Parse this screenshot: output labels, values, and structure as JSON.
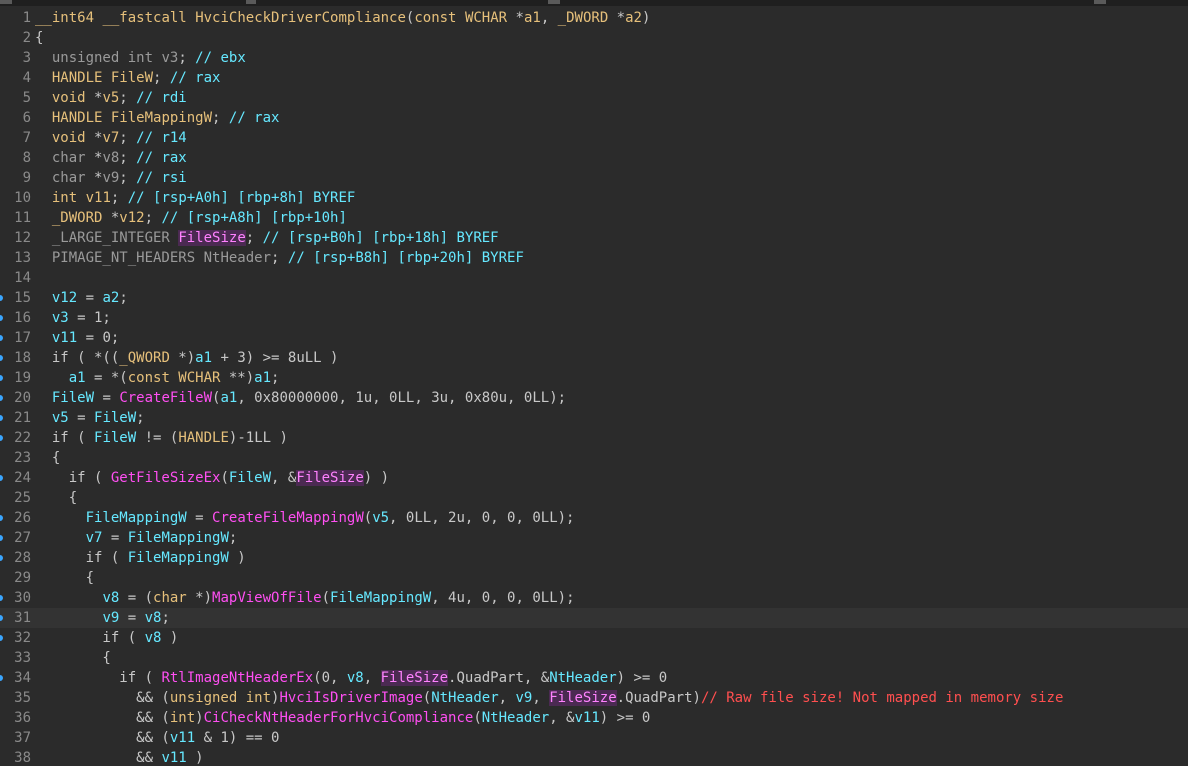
{
  "editor": {
    "lines": [
      {
        "n": "1",
        "bp": false,
        "cur": false,
        "tokens": [
          [
            "kw",
            "__int64"
          ],
          [
            "pu",
            " "
          ],
          [
            "kw",
            "__fastcall"
          ],
          [
            "pu",
            " "
          ],
          [
            "kw",
            "HvciCheckDriverCompliance"
          ],
          [
            "pu",
            "("
          ],
          [
            "kw",
            "const"
          ],
          [
            "pu",
            " "
          ],
          [
            "kw",
            "WCHAR"
          ],
          [
            "pu",
            " *"
          ],
          [
            "kw",
            "a1"
          ],
          [
            "pu",
            ", "
          ],
          [
            "kw",
            "_DWORD"
          ],
          [
            "pu",
            " *"
          ],
          [
            "kw",
            "a2"
          ],
          [
            "pu",
            ")"
          ]
        ]
      },
      {
        "n": "2",
        "bp": false,
        "cur": false,
        "tokens": [
          [
            "pu",
            "{"
          ]
        ]
      },
      {
        "n": "3",
        "bp": false,
        "cur": false,
        "tokens": [
          [
            "pu",
            "  "
          ],
          [
            "ty",
            "unsigned int"
          ],
          [
            "pu",
            " "
          ],
          [
            "ty",
            "v3"
          ],
          [
            "pu",
            "; "
          ],
          [
            "cm",
            "// ebx"
          ]
        ]
      },
      {
        "n": "4",
        "bp": false,
        "cur": false,
        "tokens": [
          [
            "pu",
            "  "
          ],
          [
            "kw",
            "HANDLE"
          ],
          [
            "pu",
            " "
          ],
          [
            "kw",
            "FileW"
          ],
          [
            "pu",
            "; "
          ],
          [
            "cm",
            "// rax"
          ]
        ]
      },
      {
        "n": "5",
        "bp": false,
        "cur": false,
        "tokens": [
          [
            "pu",
            "  "
          ],
          [
            "kw",
            "void"
          ],
          [
            "pu",
            " *"
          ],
          [
            "kw",
            "v5"
          ],
          [
            "pu",
            "; "
          ],
          [
            "cm",
            "// rdi"
          ]
        ]
      },
      {
        "n": "6",
        "bp": false,
        "cur": false,
        "tokens": [
          [
            "pu",
            "  "
          ],
          [
            "kw",
            "HANDLE"
          ],
          [
            "pu",
            " "
          ],
          [
            "kw",
            "FileMappingW"
          ],
          [
            "pu",
            "; "
          ],
          [
            "cm",
            "// rax"
          ]
        ]
      },
      {
        "n": "7",
        "bp": false,
        "cur": false,
        "tokens": [
          [
            "pu",
            "  "
          ],
          [
            "kw",
            "void"
          ],
          [
            "pu",
            " *"
          ],
          [
            "kw",
            "v7"
          ],
          [
            "pu",
            "; "
          ],
          [
            "cm",
            "// r14"
          ]
        ]
      },
      {
        "n": "8",
        "bp": false,
        "cur": false,
        "tokens": [
          [
            "pu",
            "  "
          ],
          [
            "ty",
            "char"
          ],
          [
            "pu",
            " *"
          ],
          [
            "ty",
            "v8"
          ],
          [
            "pu",
            "; "
          ],
          [
            "cm",
            "// rax"
          ]
        ]
      },
      {
        "n": "9",
        "bp": false,
        "cur": false,
        "tokens": [
          [
            "pu",
            "  "
          ],
          [
            "ty",
            "char"
          ],
          [
            "pu",
            " *"
          ],
          [
            "ty",
            "v9"
          ],
          [
            "pu",
            "; "
          ],
          [
            "cm",
            "// rsi"
          ]
        ]
      },
      {
        "n": "10",
        "bp": false,
        "cur": false,
        "tokens": [
          [
            "pu",
            "  "
          ],
          [
            "kw",
            "int"
          ],
          [
            "pu",
            " "
          ],
          [
            "kw",
            "v11"
          ],
          [
            "pu",
            "; "
          ],
          [
            "cm",
            "// [rsp+A0h] [rbp+8h] BYREF"
          ]
        ]
      },
      {
        "n": "11",
        "bp": false,
        "cur": false,
        "tokens": [
          [
            "pu",
            "  "
          ],
          [
            "kw",
            "_DWORD"
          ],
          [
            "pu",
            " *"
          ],
          [
            "kw",
            "v12"
          ],
          [
            "pu",
            "; "
          ],
          [
            "cm",
            "// [rsp+A8h] [rbp+10h]"
          ]
        ]
      },
      {
        "n": "12",
        "bp": false,
        "cur": false,
        "tokens": [
          [
            "pu",
            "  "
          ],
          [
            "ty",
            "_LARGE_INTEGER"
          ],
          [
            "pu",
            " "
          ],
          [
            "hl",
            "FileSize"
          ],
          [
            "pu",
            "; "
          ],
          [
            "cm",
            "// [rsp+B0h] [rbp+18h] BYREF"
          ]
        ]
      },
      {
        "n": "13",
        "bp": false,
        "cur": false,
        "tokens": [
          [
            "pu",
            "  "
          ],
          [
            "ty",
            "PIMAGE_NT_HEADERS"
          ],
          [
            "pu",
            " "
          ],
          [
            "ty",
            "NtHeader"
          ],
          [
            "pu",
            "; "
          ],
          [
            "cm",
            "// [rsp+B8h] [rbp+20h] BYREF"
          ]
        ]
      },
      {
        "n": "14",
        "bp": false,
        "cur": false,
        "tokens": []
      },
      {
        "n": "15",
        "bp": true,
        "cur": false,
        "tokens": [
          [
            "pu",
            "  "
          ],
          [
            "id",
            "v12"
          ],
          [
            "pu",
            " = "
          ],
          [
            "id",
            "a2"
          ],
          [
            "pu",
            ";"
          ]
        ]
      },
      {
        "n": "16",
        "bp": true,
        "cur": false,
        "tokens": [
          [
            "pu",
            "  "
          ],
          [
            "id",
            "v3"
          ],
          [
            "pu",
            " = 1;"
          ]
        ]
      },
      {
        "n": "17",
        "bp": true,
        "cur": false,
        "tokens": [
          [
            "pu",
            "  "
          ],
          [
            "id",
            "v11"
          ],
          [
            "pu",
            " = 0;"
          ]
        ]
      },
      {
        "n": "18",
        "bp": true,
        "cur": false,
        "tokens": [
          [
            "pu",
            "  if ( *(("
          ],
          [
            "kw",
            "_QWORD"
          ],
          [
            "pu",
            " *)"
          ],
          [
            "id",
            "a1"
          ],
          [
            "pu",
            " + 3) >= 8uLL )"
          ]
        ]
      },
      {
        "n": "19",
        "bp": true,
        "cur": false,
        "tokens": [
          [
            "pu",
            "    "
          ],
          [
            "id",
            "a1"
          ],
          [
            "pu",
            " = *("
          ],
          [
            "kw",
            "const WCHAR"
          ],
          [
            "pu",
            " **)"
          ],
          [
            "id",
            "a1"
          ],
          [
            "pu",
            ";"
          ]
        ]
      },
      {
        "n": "20",
        "bp": true,
        "cur": false,
        "tokens": [
          [
            "pu",
            "  "
          ],
          [
            "id",
            "FileW"
          ],
          [
            "pu",
            " = "
          ],
          [
            "fn",
            "CreateFileW"
          ],
          [
            "pu",
            "("
          ],
          [
            "id",
            "a1"
          ],
          [
            "pu",
            ", 0x80000000, 1u, 0LL, 3u, 0x80u, 0LL);"
          ]
        ]
      },
      {
        "n": "21",
        "bp": true,
        "cur": false,
        "tokens": [
          [
            "pu",
            "  "
          ],
          [
            "id",
            "v5"
          ],
          [
            "pu",
            " = "
          ],
          [
            "id",
            "FileW"
          ],
          [
            "pu",
            ";"
          ]
        ]
      },
      {
        "n": "22",
        "bp": true,
        "cur": false,
        "tokens": [
          [
            "pu",
            "  if ( "
          ],
          [
            "id",
            "FileW"
          ],
          [
            "pu",
            " != ("
          ],
          [
            "kw",
            "HANDLE"
          ],
          [
            "pu",
            ")-1LL )"
          ]
        ]
      },
      {
        "n": "23",
        "bp": false,
        "cur": false,
        "tokens": [
          [
            "pu",
            "  {"
          ]
        ]
      },
      {
        "n": "24",
        "bp": true,
        "cur": false,
        "tokens": [
          [
            "pu",
            "    if ( "
          ],
          [
            "fn",
            "GetFileSizeEx"
          ],
          [
            "pu",
            "("
          ],
          [
            "id",
            "FileW"
          ],
          [
            "pu",
            ", &"
          ],
          [
            "hl",
            "FileSize"
          ],
          [
            "pu",
            ") )"
          ]
        ]
      },
      {
        "n": "25",
        "bp": false,
        "cur": false,
        "tokens": [
          [
            "pu",
            "    {"
          ]
        ]
      },
      {
        "n": "26",
        "bp": true,
        "cur": false,
        "tokens": [
          [
            "pu",
            "      "
          ],
          [
            "id",
            "FileMappingW"
          ],
          [
            "pu",
            " = "
          ],
          [
            "fn",
            "CreateFileMappingW"
          ],
          [
            "pu",
            "("
          ],
          [
            "id",
            "v5"
          ],
          [
            "pu",
            ", 0LL, 2u, 0, 0, 0LL);"
          ]
        ]
      },
      {
        "n": "27",
        "bp": true,
        "cur": false,
        "tokens": [
          [
            "pu",
            "      "
          ],
          [
            "id",
            "v7"
          ],
          [
            "pu",
            " = "
          ],
          [
            "id",
            "FileMappingW"
          ],
          [
            "pu",
            ";"
          ]
        ]
      },
      {
        "n": "28",
        "bp": true,
        "cur": false,
        "tokens": [
          [
            "pu",
            "      if ( "
          ],
          [
            "id",
            "FileMappingW"
          ],
          [
            "pu",
            " )"
          ]
        ]
      },
      {
        "n": "29",
        "bp": false,
        "cur": false,
        "tokens": [
          [
            "pu",
            "      {"
          ]
        ]
      },
      {
        "n": "30",
        "bp": true,
        "cur": false,
        "tokens": [
          [
            "pu",
            "        "
          ],
          [
            "id",
            "v8"
          ],
          [
            "pu",
            " = ("
          ],
          [
            "kw",
            "char"
          ],
          [
            "pu",
            " *)"
          ],
          [
            "fn",
            "MapViewOfFile"
          ],
          [
            "pu",
            "("
          ],
          [
            "id",
            "FileMappingW"
          ],
          [
            "pu",
            ", 4u, 0, 0, 0LL);"
          ]
        ]
      },
      {
        "n": "31",
        "bp": true,
        "cur": true,
        "tokens": [
          [
            "pu",
            "        "
          ],
          [
            "id",
            "v9"
          ],
          [
            "pu",
            " = "
          ],
          [
            "id",
            "v8"
          ],
          [
            "pu",
            ";"
          ]
        ]
      },
      {
        "n": "32",
        "bp": true,
        "cur": false,
        "tokens": [
          [
            "pu",
            "        if ( "
          ],
          [
            "id",
            "v8"
          ],
          [
            "pu",
            " )"
          ]
        ]
      },
      {
        "n": "33",
        "bp": false,
        "cur": false,
        "tokens": [
          [
            "pu",
            "        {"
          ]
        ]
      },
      {
        "n": "34",
        "bp": true,
        "cur": false,
        "tokens": [
          [
            "pu",
            "          if ( "
          ],
          [
            "fn",
            "RtlImageNtHeaderEx"
          ],
          [
            "pu",
            "(0, "
          ],
          [
            "id",
            "v8"
          ],
          [
            "pu",
            ", "
          ],
          [
            "hl",
            "FileSize"
          ],
          [
            "pu",
            ".QuadPart, &"
          ],
          [
            "id",
            "NtHeader"
          ],
          [
            "pu",
            ") >= 0"
          ]
        ]
      },
      {
        "n": "35",
        "bp": false,
        "cur": false,
        "tokens": [
          [
            "pu",
            "            && ("
          ],
          [
            "kw",
            "unsigned int"
          ],
          [
            "pu",
            ")"
          ],
          [
            "fn",
            "HvciIsDriverImage"
          ],
          [
            "pu",
            "("
          ],
          [
            "id",
            "NtHeader"
          ],
          [
            "pu",
            ", "
          ],
          [
            "id",
            "v9"
          ],
          [
            "pu",
            ", "
          ],
          [
            "hl",
            "FileSize"
          ],
          [
            "pu",
            ".QuadPart)"
          ],
          [
            "cm2",
            "// Raw file size! Not mapped in memory size"
          ]
        ]
      },
      {
        "n": "36",
        "bp": false,
        "cur": false,
        "tokens": [
          [
            "pu",
            "            && ("
          ],
          [
            "kw",
            "int"
          ],
          [
            "pu",
            ")"
          ],
          [
            "fn",
            "CiCheckNtHeaderForHvciCompliance"
          ],
          [
            "pu",
            "("
          ],
          [
            "id",
            "NtHeader"
          ],
          [
            "pu",
            ", &"
          ],
          [
            "id",
            "v11"
          ],
          [
            "pu",
            ") >= 0"
          ]
        ]
      },
      {
        "n": "37",
        "bp": false,
        "cur": false,
        "tokens": [
          [
            "pu",
            "            && ("
          ],
          [
            "id",
            "v11"
          ],
          [
            "pu",
            " & 1) == 0"
          ]
        ]
      },
      {
        "n": "38",
        "bp": false,
        "cur": false,
        "tokens": [
          [
            "pu",
            "            && "
          ],
          [
            "id",
            "v11"
          ],
          [
            "pu",
            " )"
          ]
        ]
      }
    ]
  }
}
